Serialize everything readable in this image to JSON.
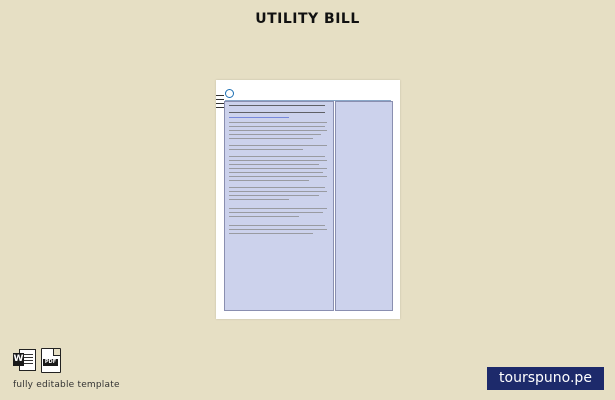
{
  "header": {
    "title": "UTILITY BILL"
  },
  "footer": {
    "icons": [
      "word-icon",
      "pdf-icon"
    ],
    "word_badge": "W",
    "pdf_badge": "PDF",
    "caption": "fully editable template"
  },
  "brand": {
    "site": "tourspuno.pe"
  },
  "colors": {
    "background": "#e6dfc4",
    "panel": "#ccd2ec",
    "badge": "#1d2a6b",
    "accent": "#1c6fb3"
  }
}
